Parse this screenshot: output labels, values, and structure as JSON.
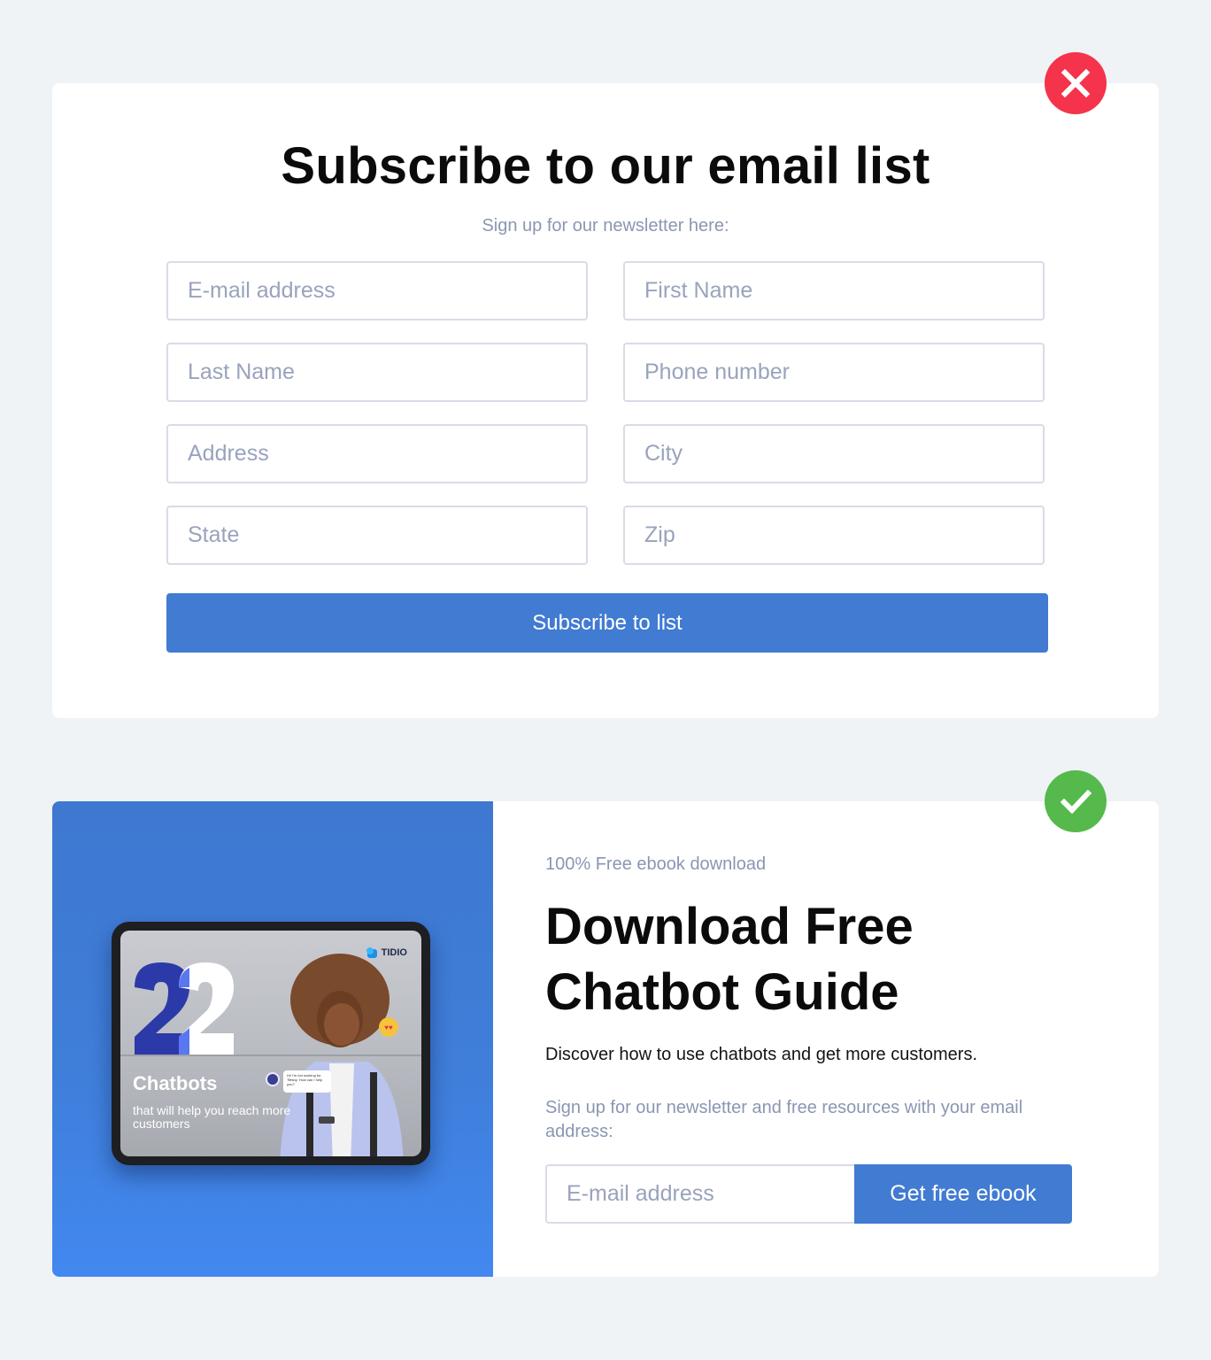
{
  "bad_example": {
    "badge_icon": "close-icon",
    "badge_color": "#f5334a",
    "title": "Subscribe to our email list",
    "subtitle": "Sign up for our newsletter here:",
    "fields": [
      {
        "placeholder": "E-mail address",
        "value": ""
      },
      {
        "placeholder": "First Name",
        "value": ""
      },
      {
        "placeholder": "Last Name",
        "value": ""
      },
      {
        "placeholder": "Phone number",
        "value": ""
      },
      {
        "placeholder": "Address",
        "value": ""
      },
      {
        "placeholder": "City",
        "value": ""
      },
      {
        "placeholder": "State",
        "value": ""
      },
      {
        "placeholder": "Zip",
        "value": ""
      }
    ],
    "submit_label": "Subscribe to list",
    "accent_color": "#417bd2"
  },
  "good_example": {
    "badge_icon": "checkmark-icon",
    "badge_color": "#55b94b",
    "ebook_cover": {
      "brand": "TIDIO",
      "number": "22",
      "title": "Chatbots",
      "tagline": "that will help you reach more customers",
      "chat_message": "Hi! I'm bot working for Tiffany. How can I help you?"
    },
    "kicker": "100% Free ebook download",
    "title_line1": "Download Free",
    "title_line2": "Chatbot Guide",
    "description": "Discover how to use chatbots and get more customers.",
    "note": "Sign up for our newsletter and free resources with your email address:",
    "email_field": {
      "placeholder": "E-mail address",
      "value": ""
    },
    "button_label": "Get free ebook",
    "panel_color": "#3e78d1",
    "accent_color": "#417bd2"
  }
}
